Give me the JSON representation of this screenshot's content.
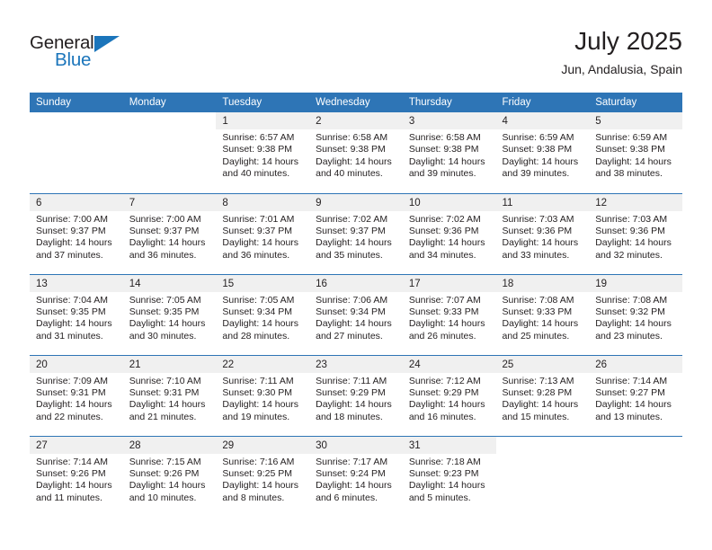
{
  "brand": {
    "name_part1": "General",
    "name_part2": "Blue",
    "triangle_color": "#1b75bb"
  },
  "header": {
    "title": "July 2025",
    "subtitle": "Jun, Andalusia, Spain"
  },
  "theme": {
    "header_blue": "#2e75b6",
    "daynum_band": "#f0f0f0",
    "text": "#231f20"
  },
  "weekday_headers": [
    "Sunday",
    "Monday",
    "Tuesday",
    "Wednesday",
    "Thursday",
    "Friday",
    "Saturday"
  ],
  "labels": {
    "sunrise_prefix": "Sunrise: ",
    "sunset_prefix": "Sunset: ",
    "daylight_prefix": "Daylight: "
  },
  "weeks": [
    [
      {
        "day": "",
        "empty": true
      },
      {
        "day": "",
        "empty": true
      },
      {
        "day": "1",
        "sunrise": "Sunrise: 6:57 AM",
        "sunset": "Sunset: 9:38 PM",
        "daylight": "Daylight: 14 hours and 40 minutes."
      },
      {
        "day": "2",
        "sunrise": "Sunrise: 6:58 AM",
        "sunset": "Sunset: 9:38 PM",
        "daylight": "Daylight: 14 hours and 40 minutes."
      },
      {
        "day": "3",
        "sunrise": "Sunrise: 6:58 AM",
        "sunset": "Sunset: 9:38 PM",
        "daylight": "Daylight: 14 hours and 39 minutes."
      },
      {
        "day": "4",
        "sunrise": "Sunrise: 6:59 AM",
        "sunset": "Sunset: 9:38 PM",
        "daylight": "Daylight: 14 hours and 39 minutes."
      },
      {
        "day": "5",
        "sunrise": "Sunrise: 6:59 AM",
        "sunset": "Sunset: 9:38 PM",
        "daylight": "Daylight: 14 hours and 38 minutes."
      }
    ],
    [
      {
        "day": "6",
        "sunrise": "Sunrise: 7:00 AM",
        "sunset": "Sunset: 9:37 PM",
        "daylight": "Daylight: 14 hours and 37 minutes."
      },
      {
        "day": "7",
        "sunrise": "Sunrise: 7:00 AM",
        "sunset": "Sunset: 9:37 PM",
        "daylight": "Daylight: 14 hours and 36 minutes."
      },
      {
        "day": "8",
        "sunrise": "Sunrise: 7:01 AM",
        "sunset": "Sunset: 9:37 PM",
        "daylight": "Daylight: 14 hours and 36 minutes."
      },
      {
        "day": "9",
        "sunrise": "Sunrise: 7:02 AM",
        "sunset": "Sunset: 9:37 PM",
        "daylight": "Daylight: 14 hours and 35 minutes."
      },
      {
        "day": "10",
        "sunrise": "Sunrise: 7:02 AM",
        "sunset": "Sunset: 9:36 PM",
        "daylight": "Daylight: 14 hours and 34 minutes."
      },
      {
        "day": "11",
        "sunrise": "Sunrise: 7:03 AM",
        "sunset": "Sunset: 9:36 PM",
        "daylight": "Daylight: 14 hours and 33 minutes."
      },
      {
        "day": "12",
        "sunrise": "Sunrise: 7:03 AM",
        "sunset": "Sunset: 9:36 PM",
        "daylight": "Daylight: 14 hours and 32 minutes."
      }
    ],
    [
      {
        "day": "13",
        "sunrise": "Sunrise: 7:04 AM",
        "sunset": "Sunset: 9:35 PM",
        "daylight": "Daylight: 14 hours and 31 minutes."
      },
      {
        "day": "14",
        "sunrise": "Sunrise: 7:05 AM",
        "sunset": "Sunset: 9:35 PM",
        "daylight": "Daylight: 14 hours and 30 minutes."
      },
      {
        "day": "15",
        "sunrise": "Sunrise: 7:05 AM",
        "sunset": "Sunset: 9:34 PM",
        "daylight": "Daylight: 14 hours and 28 minutes."
      },
      {
        "day": "16",
        "sunrise": "Sunrise: 7:06 AM",
        "sunset": "Sunset: 9:34 PM",
        "daylight": "Daylight: 14 hours and 27 minutes."
      },
      {
        "day": "17",
        "sunrise": "Sunrise: 7:07 AM",
        "sunset": "Sunset: 9:33 PM",
        "daylight": "Daylight: 14 hours and 26 minutes."
      },
      {
        "day": "18",
        "sunrise": "Sunrise: 7:08 AM",
        "sunset": "Sunset: 9:33 PM",
        "daylight": "Daylight: 14 hours and 25 minutes."
      },
      {
        "day": "19",
        "sunrise": "Sunrise: 7:08 AM",
        "sunset": "Sunset: 9:32 PM",
        "daylight": "Daylight: 14 hours and 23 minutes."
      }
    ],
    [
      {
        "day": "20",
        "sunrise": "Sunrise: 7:09 AM",
        "sunset": "Sunset: 9:31 PM",
        "daylight": "Daylight: 14 hours and 22 minutes."
      },
      {
        "day": "21",
        "sunrise": "Sunrise: 7:10 AM",
        "sunset": "Sunset: 9:31 PM",
        "daylight": "Daylight: 14 hours and 21 minutes."
      },
      {
        "day": "22",
        "sunrise": "Sunrise: 7:11 AM",
        "sunset": "Sunset: 9:30 PM",
        "daylight": "Daylight: 14 hours and 19 minutes."
      },
      {
        "day": "23",
        "sunrise": "Sunrise: 7:11 AM",
        "sunset": "Sunset: 9:29 PM",
        "daylight": "Daylight: 14 hours and 18 minutes."
      },
      {
        "day": "24",
        "sunrise": "Sunrise: 7:12 AM",
        "sunset": "Sunset: 9:29 PM",
        "daylight": "Daylight: 14 hours and 16 minutes."
      },
      {
        "day": "25",
        "sunrise": "Sunrise: 7:13 AM",
        "sunset": "Sunset: 9:28 PM",
        "daylight": "Daylight: 14 hours and 15 minutes."
      },
      {
        "day": "26",
        "sunrise": "Sunrise: 7:14 AM",
        "sunset": "Sunset: 9:27 PM",
        "daylight": "Daylight: 14 hours and 13 minutes."
      }
    ],
    [
      {
        "day": "27",
        "sunrise": "Sunrise: 7:14 AM",
        "sunset": "Sunset: 9:26 PM",
        "daylight": "Daylight: 14 hours and 11 minutes."
      },
      {
        "day": "28",
        "sunrise": "Sunrise: 7:15 AM",
        "sunset": "Sunset: 9:26 PM",
        "daylight": "Daylight: 14 hours and 10 minutes."
      },
      {
        "day": "29",
        "sunrise": "Sunrise: 7:16 AM",
        "sunset": "Sunset: 9:25 PM",
        "daylight": "Daylight: 14 hours and 8 minutes."
      },
      {
        "day": "30",
        "sunrise": "Sunrise: 7:17 AM",
        "sunset": "Sunset: 9:24 PM",
        "daylight": "Daylight: 14 hours and 6 minutes."
      },
      {
        "day": "31",
        "sunrise": "Sunrise: 7:18 AM",
        "sunset": "Sunset: 9:23 PM",
        "daylight": "Daylight: 14 hours and 5 minutes."
      },
      {
        "day": "",
        "empty": true
      },
      {
        "day": "",
        "empty": true
      }
    ]
  ]
}
